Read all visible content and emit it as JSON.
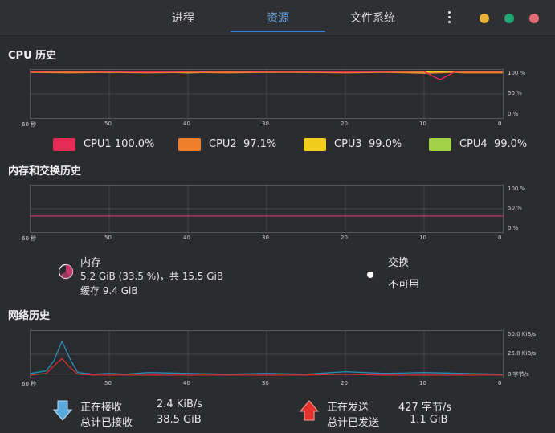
{
  "header": {
    "tabs": [
      {
        "label": "进程"
      },
      {
        "label": "资源",
        "active": true
      },
      {
        "label": "文件系统"
      }
    ],
    "window_dots": [
      "#e8b339",
      "#23a675",
      "#e06b74"
    ]
  },
  "cpu": {
    "title": "CPU 历史",
    "x_ticks": [
      "60 秒",
      "50",
      "40",
      "30",
      "20",
      "10",
      "0"
    ],
    "y_ticks": [
      "100 %",
      "50 %",
      "0 %"
    ],
    "legend": [
      {
        "name": "CPU1",
        "value": "100.0%",
        "color": "#e52a54"
      },
      {
        "name": "CPU2",
        "value": "97.1%",
        "color": "#ef7f2b"
      },
      {
        "name": "CPU3",
        "value": "99.0%",
        "color": "#f2cf1f"
      },
      {
        "name": "CPU4",
        "value": "99.0%",
        "color": "#a3d147"
      }
    ]
  },
  "memory": {
    "title": "内存和交换历史",
    "x_ticks": [
      "60 秒",
      "50",
      "40",
      "30",
      "20",
      "10",
      "0"
    ],
    "y_ticks": [
      "100 %",
      "50 %",
      "0 %"
    ],
    "mem_label": "内存",
    "mem_line1": "5.2 GiB (33.5 %)，共 15.5 GiB",
    "mem_line2": "缓存 9.4 GiB",
    "swap_label": "交换",
    "swap_value": "不可用",
    "mem_color": "#c43a6b"
  },
  "network": {
    "title": "网络历史",
    "x_ticks": [
      "60 秒",
      "50",
      "40",
      "30",
      "20",
      "10",
      "0"
    ],
    "y_ticks": [
      "50.0 KiB/s",
      "25.0 KiB/s",
      "0 字节/s"
    ],
    "recv_label": "正在接收",
    "recv_value": "2.4 KiB/s",
    "recv_total_label": "总计已接收",
    "recv_total_value": "38.5 GiB",
    "send_label": "正在发送",
    "send_value": "427 字节/s",
    "send_total_label": "总计已发送",
    "send_total_value": "1.1 GiB",
    "recv_color": "#2a8db8",
    "send_color": "#d62d2d"
  },
  "chart_data": [
    {
      "type": "line",
      "title": "CPU 历史",
      "x": [
        60,
        55,
        50,
        45,
        40,
        35,
        30,
        25,
        20,
        15,
        10,
        8,
        6,
        5,
        0
      ],
      "series": [
        {
          "name": "CPU1",
          "values": [
            100,
            100,
            100,
            99,
            100,
            100,
            100,
            100,
            99,
            100,
            100,
            82,
            100,
            100,
            100
          ]
        },
        {
          "name": "CPU2",
          "values": [
            98,
            97,
            98,
            97,
            98,
            97,
            98,
            98,
            97,
            98,
            96,
            97,
            98,
            97,
            97
          ]
        },
        {
          "name": "CPU3",
          "values": [
            99,
            99,
            98,
            99,
            97,
            99,
            99,
            98,
            99,
            99,
            99,
            99,
            99,
            99,
            99
          ]
        },
        {
          "name": "CPU4",
          "values": [
            99,
            99,
            99,
            98,
            99,
            99,
            98,
            99,
            99,
            99,
            98,
            99,
            99,
            99,
            99
          ]
        }
      ],
      "ylim": [
        0,
        100
      ]
    },
    {
      "type": "line",
      "title": "内存和交换历史",
      "x": [
        60,
        0
      ],
      "series": [
        {
          "name": "内存",
          "values": [
            33.5,
            33.5
          ]
        }
      ],
      "ylim": [
        0,
        100
      ]
    },
    {
      "type": "line",
      "title": "网络历史",
      "x": [
        60,
        58,
        57,
        56,
        55,
        54,
        52,
        50,
        48,
        45,
        40,
        35,
        30,
        25,
        20,
        15,
        10,
        5,
        0
      ],
      "series": [
        {
          "name": "正在接收",
          "values": [
            3,
            6,
            18,
            40,
            20,
            4,
            2,
            3,
            2,
            4,
            3,
            2,
            3,
            2,
            5,
            3,
            4,
            3,
            2
          ]
        },
        {
          "name": "正在发送",
          "values": [
            1,
            3,
            12,
            20,
            10,
            2,
            1,
            1,
            1,
            1,
            1,
            1,
            1,
            1,
            2,
            1,
            1,
            1,
            1
          ]
        }
      ],
      "ylim": [
        0,
        50
      ]
    }
  ]
}
